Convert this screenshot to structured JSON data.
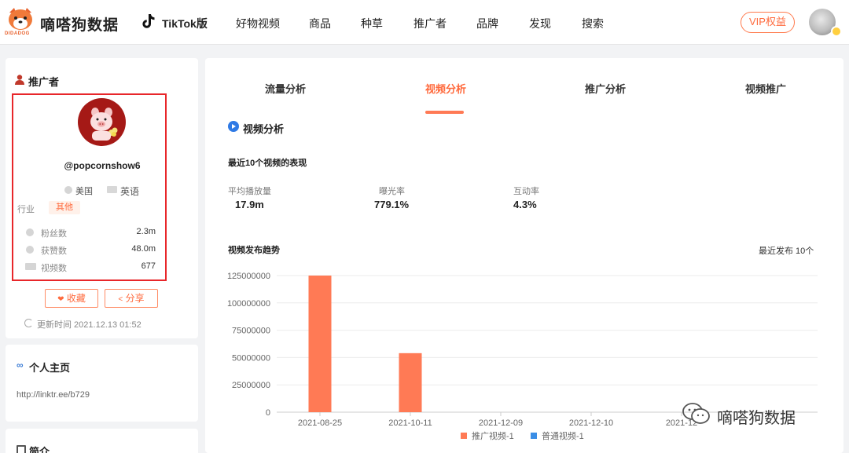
{
  "header": {
    "brand": "嘀嗒狗数据",
    "logo_caption": "DIDADOG",
    "nav": [
      "TikTok版",
      "好物视频",
      "商品",
      "种草",
      "推广者",
      "品牌",
      "发现",
      "搜索"
    ],
    "vip": "VIP权益"
  },
  "profile": {
    "title": "推广者",
    "handle": "@popcornshow6",
    "country": "美国",
    "language": "英语",
    "industry_label": "行业",
    "industry_value": "其他",
    "stats": [
      {
        "label": "粉丝数",
        "value": "2.3m"
      },
      {
        "label": "获赞数",
        "value": "48.0m"
      },
      {
        "label": "视频数",
        "value": "677"
      }
    ],
    "collect": "收藏",
    "share": "分享",
    "updated": "更新时间 2021.12.13 01:52"
  },
  "homepage": {
    "title": "个人主页",
    "link": "http://linktr.ee/b729"
  },
  "intro": {
    "title": "简介"
  },
  "main": {
    "tabs": [
      "流量分析",
      "视频分析",
      "推广分析",
      "视频推广"
    ],
    "active_tab": 1,
    "section_title": "视频分析",
    "recent_title": "最近10个视频的表现",
    "metrics": [
      {
        "label": "平均播放量",
        "value": "17.9m"
      },
      {
        "label": "曝光率",
        "value": "779.1%"
      },
      {
        "label": "互动率",
        "value": "4.3%"
      }
    ],
    "trend_title": "视频发布趋势",
    "trend_filter": "最近发布 10个"
  },
  "chart_data": {
    "type": "bar",
    "categories": [
      "2021-08-25",
      "2021-10-11",
      "2021-12-09",
      "2021-12-10",
      "2021-12"
    ],
    "series": [
      {
        "name": "推广视频-1",
        "color": "#ff7a55",
        "values": [
          125000000,
          54000000,
          0,
          0,
          0
        ]
      },
      {
        "name": "普通视频-1",
        "color": "#3a8ee6",
        "values": [
          0,
          0,
          0,
          0,
          0
        ]
      }
    ],
    "yticks": [
      "0",
      "25000000",
      "50000000",
      "75000000",
      "100000000",
      "125000000"
    ],
    "ylim": [
      0,
      125000000
    ],
    "legend": "bottom",
    "grid": true
  },
  "watermark": "嘀嗒狗数据",
  "colors": {
    "accent": "#ff6a3d",
    "highlight_box": "#e8262a"
  }
}
